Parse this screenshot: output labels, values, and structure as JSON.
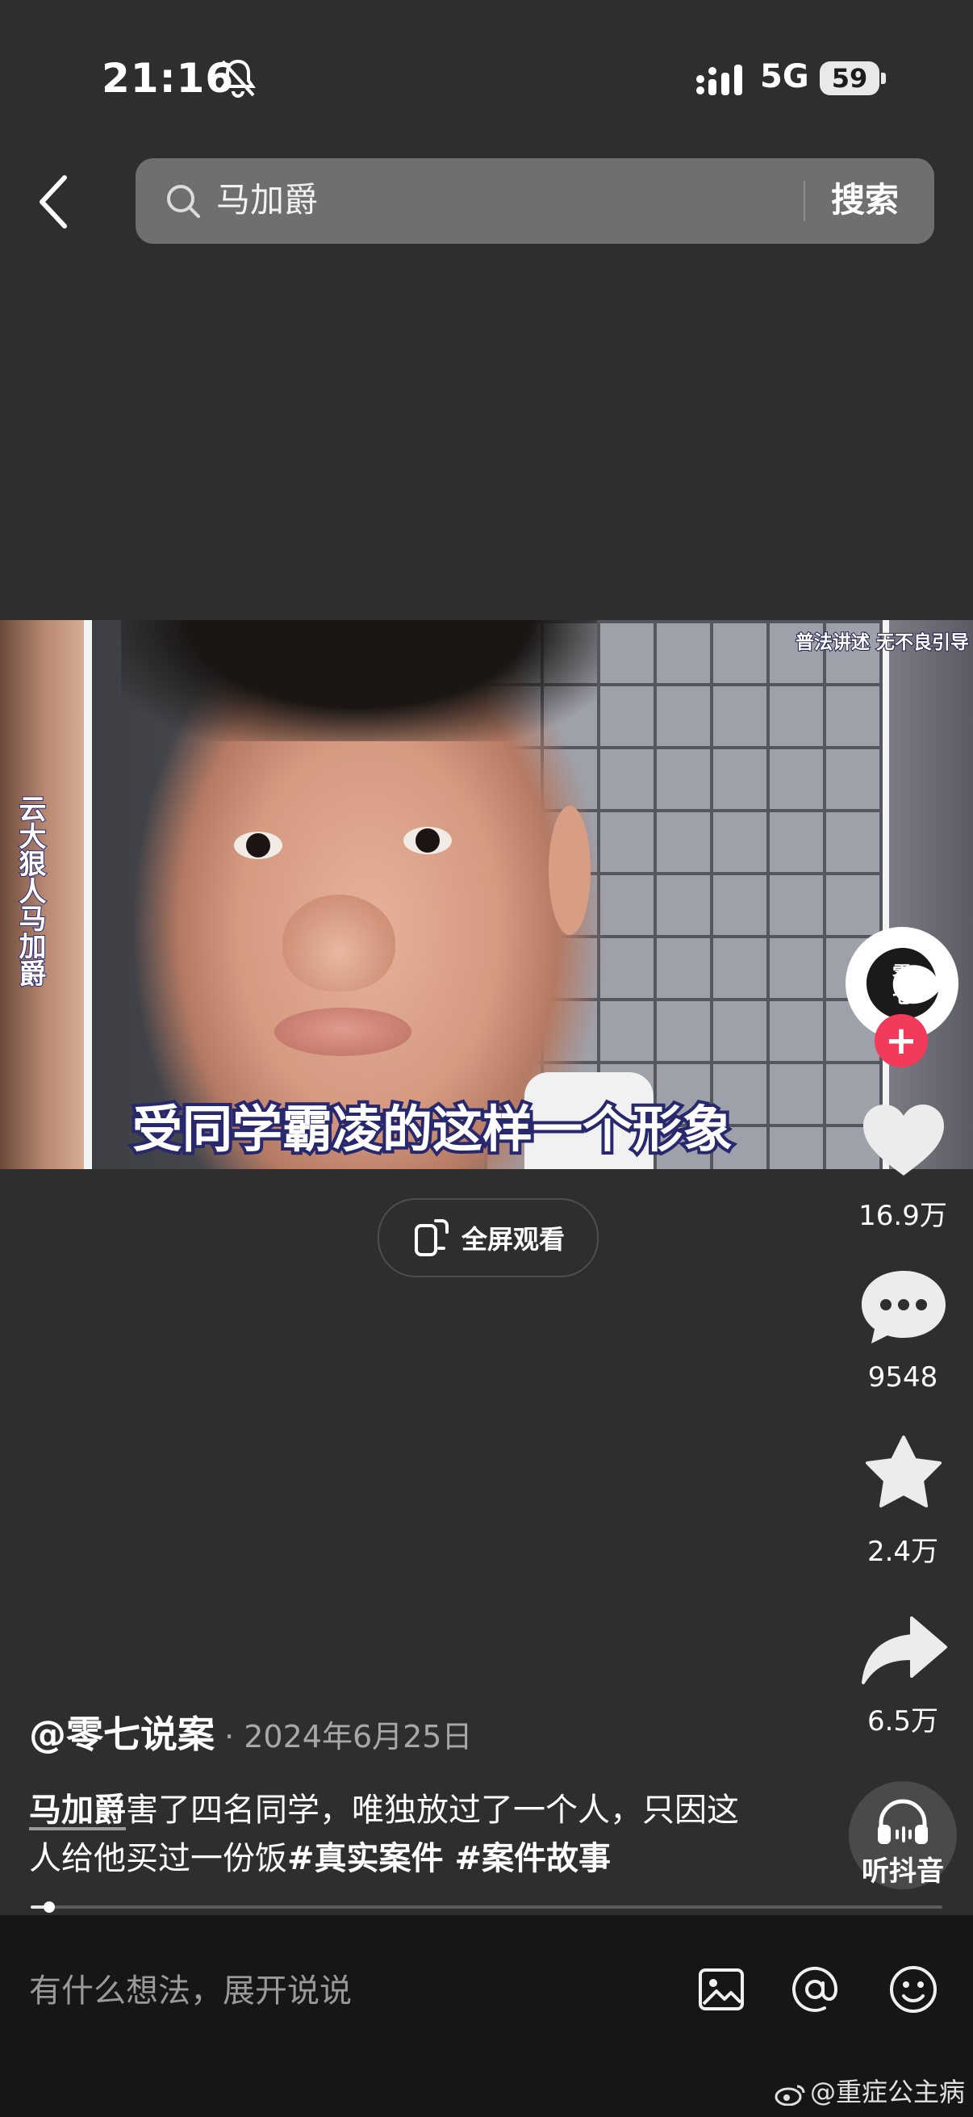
{
  "status_bar": {
    "time": "21:16",
    "network": "5G",
    "battery": "59"
  },
  "search": {
    "query": "马加爵",
    "button_label": "搜索"
  },
  "video": {
    "side_caption": "云大狠人马加爵",
    "top_tag": "普法讲述 无不良引导",
    "subtitle": "受同学霸凌的这样一个形象",
    "avatar_text": "零\n七"
  },
  "fullscreen": {
    "label": "全屏观看"
  },
  "actions": {
    "follow_label": "+",
    "like_count": "16.9万",
    "comment_count": "9548",
    "favorite_count": "2.4万",
    "share_count": "6.5万",
    "listen_label": "听抖音"
  },
  "post": {
    "author": "@零七说案",
    "separator": " · ",
    "date": "2024年6月25日",
    "keyword": "马加爵",
    "text": "害了四名同学，唯独放过了一个人，只因这人给他买过一份饭",
    "hashtags": [
      "#真实案件",
      " #案件故事"
    ],
    "progress": 0.02
  },
  "comment_bar": {
    "placeholder": "有什么想法，展开说说",
    "watermark": "@重症公主病"
  },
  "colors": {
    "background": "#2e2e2e",
    "accent_red": "#f23a5a",
    "search_bg": "#6f6f6f",
    "comment_bar_bg": "#161616"
  },
  "icons": [
    "bell-slash-icon",
    "signal-icon",
    "back-icon",
    "search-icon",
    "fullscreen-icon",
    "heart-icon",
    "comment-icon",
    "star-icon",
    "share-icon",
    "headphones-icon",
    "image-icon",
    "at-icon",
    "emoji-icon",
    "weibo-icon"
  ]
}
